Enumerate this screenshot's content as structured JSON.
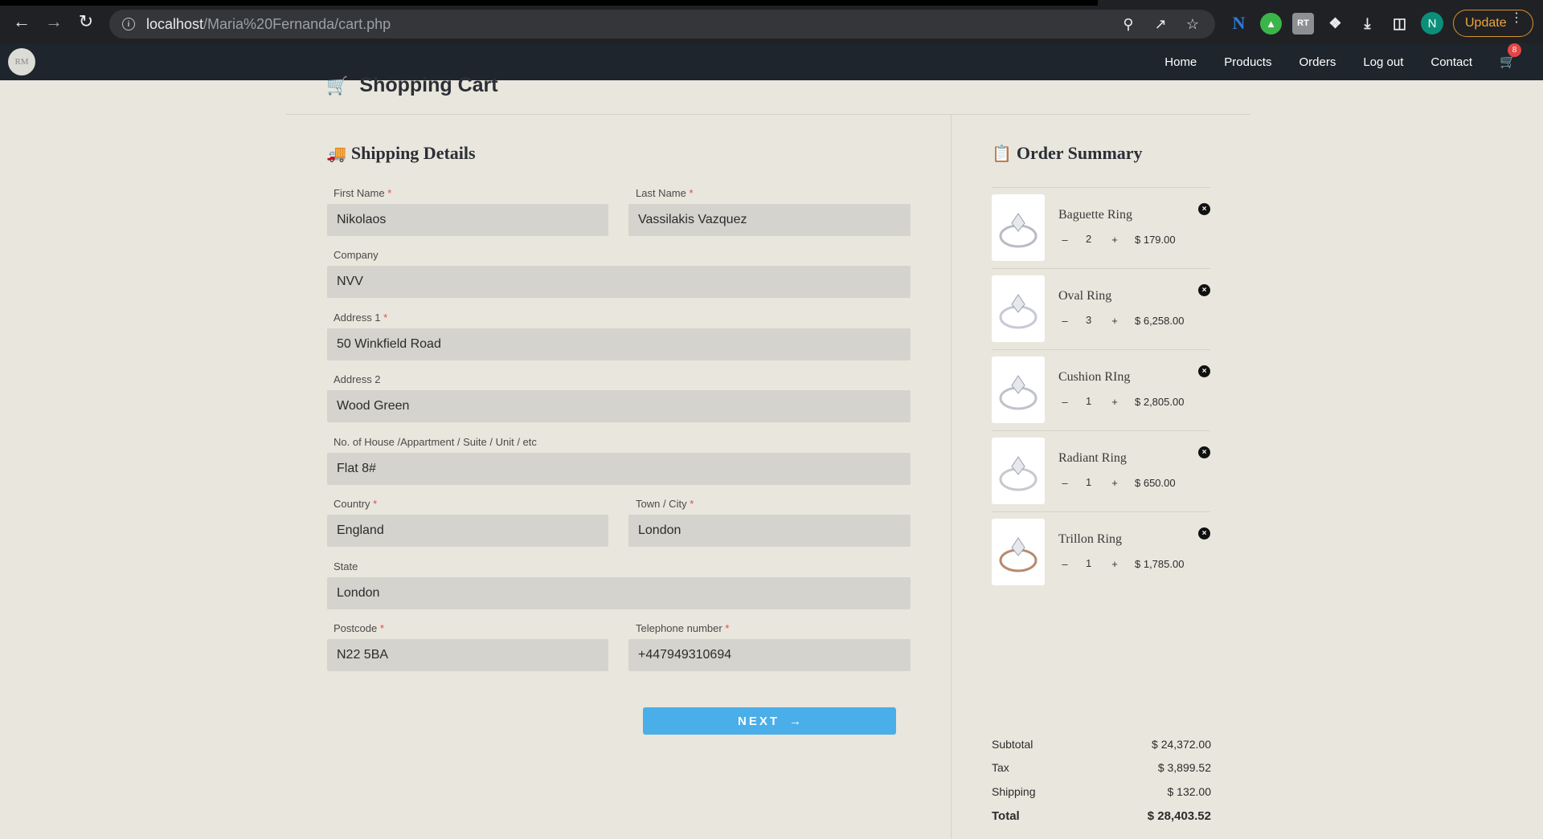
{
  "browser": {
    "url_host": "localhost",
    "url_path": "/Maria%20Fernanda/cart.php",
    "profile_initial": "N",
    "update_label": "Update",
    "ext_rt": "RT"
  },
  "nav": {
    "logo_text": "RM",
    "links": [
      "Home",
      "Products",
      "Orders",
      "Log out",
      "Contact"
    ],
    "cart_count": "8"
  },
  "page": {
    "title": "Shopping Cart"
  },
  "shipping": {
    "title": "Shipping Details",
    "fields": {
      "first_name": {
        "label": "First Name",
        "value": "Nikolaos"
      },
      "last_name": {
        "label": "Last Name",
        "value": "Vassilakis Vazquez"
      },
      "company": {
        "label": "Company",
        "value": "NVV"
      },
      "address1": {
        "label": "Address 1",
        "value": "50 Winkfield Road"
      },
      "address2": {
        "label": "Address 2",
        "value": "Wood Green"
      },
      "house": {
        "label": "No. of House /Appartment / Suite / Unit / etc",
        "value": "Flat 8#"
      },
      "country": {
        "label": "Country",
        "value": "England"
      },
      "city": {
        "label": "Town / City",
        "value": "London"
      },
      "state": {
        "label": "State",
        "value": "London"
      },
      "postcode": {
        "label": "Postcode",
        "value": "N22 5BA"
      },
      "phone": {
        "label": "Telephone number",
        "value": "+447949310694"
      }
    },
    "required_mark": "*",
    "next_label": "NEXT"
  },
  "summary": {
    "title": "Order Summary",
    "items": [
      {
        "name": "Baguette Ring",
        "qty": "2",
        "price": "$ 179.00"
      },
      {
        "name": "Oval Ring",
        "qty": "3",
        "price": "$ 6,258.00"
      },
      {
        "name": "Cushion RIng",
        "qty": "1",
        "price": "$ 2,805.00"
      },
      {
        "name": "Radiant Ring",
        "qty": "1",
        "price": "$ 650.00"
      },
      {
        "name": "Trillon Ring",
        "qty": "1",
        "price": "$ 1,785.00"
      }
    ],
    "subtotal_label": "Subtotal",
    "subtotal": "$ 24,372.00",
    "tax_label": "Tax",
    "tax": "$ 3,899.52",
    "shipping_label": "Shipping",
    "shipping": "$ 132.00",
    "total_label": "Total",
    "total": "$ 28,403.52"
  },
  "colors": {
    "page_bg": "#e9e6dd",
    "nav_bg": "#1e252d",
    "accent": "#4aaee8",
    "required": "#e24a4a"
  }
}
